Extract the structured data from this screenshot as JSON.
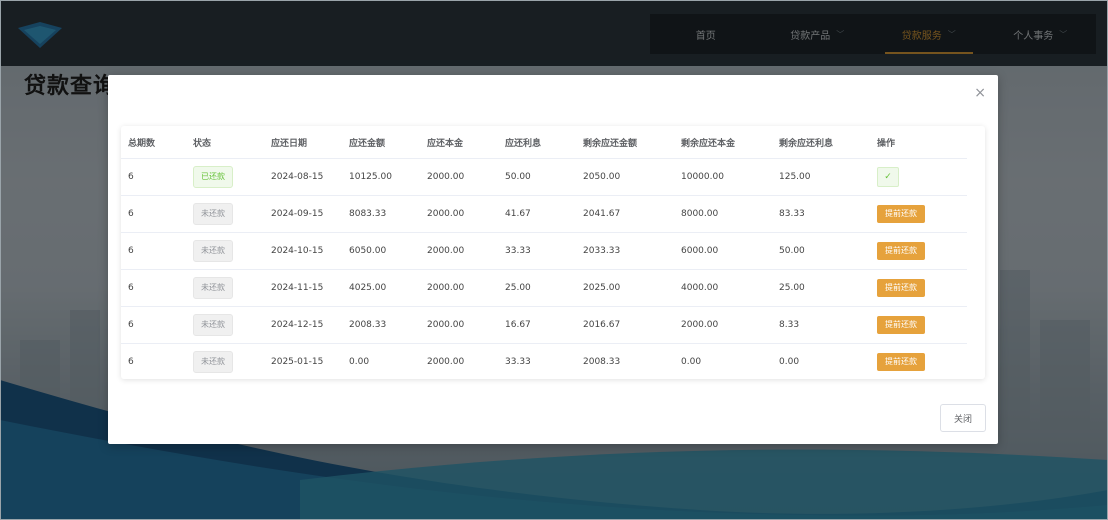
{
  "page": {
    "title": "贷款查询"
  },
  "nav": {
    "items": [
      {
        "label": "首页",
        "chevron": false,
        "active": false
      },
      {
        "label": "贷款产品",
        "chevron": true,
        "active": false
      },
      {
        "label": "贷款服务",
        "chevron": true,
        "active": true
      },
      {
        "label": "个人事务",
        "chevron": true,
        "active": false
      }
    ]
  },
  "colors": {
    "accent": "#e6a23c",
    "nav_active": "#e2a23a",
    "paid_green": "#67c23a"
  },
  "dialog": {
    "close_icon": "×",
    "columns": [
      "总期数",
      "状态",
      "应还日期",
      "应还金额",
      "应还本金",
      "应还利息",
      "剩余应还金额",
      "剩余应还本金",
      "剩余应还利息",
      "操作"
    ],
    "rows": [
      {
        "periods": "6",
        "status": "已还款",
        "status_type": "paid",
        "due_date": "2024-08-15",
        "amount": "10125.00",
        "principal": "2000.00",
        "interest": "50.00",
        "remaining_amount": "2050.00",
        "remaining_principal": "10000.00",
        "remaining_interest": "125.00",
        "action": "✓",
        "action_type": "done"
      },
      {
        "periods": "6",
        "status": "未还款",
        "status_type": "unpaid",
        "due_date": "2024-09-15",
        "amount": "8083.33",
        "principal": "2000.00",
        "interest": "41.67",
        "remaining_amount": "2041.67",
        "remaining_principal": "8000.00",
        "remaining_interest": "83.33",
        "action": "提前还款",
        "action_type": "button"
      },
      {
        "periods": "6",
        "status": "未还款",
        "status_type": "unpaid",
        "due_date": "2024-10-15",
        "amount": "6050.00",
        "principal": "2000.00",
        "interest": "33.33",
        "remaining_amount": "2033.33",
        "remaining_principal": "6000.00",
        "remaining_interest": "50.00",
        "action": "提前还款",
        "action_type": "button"
      },
      {
        "periods": "6",
        "status": "未还款",
        "status_type": "unpaid",
        "due_date": "2024-11-15",
        "amount": "4025.00",
        "principal": "2000.00",
        "interest": "25.00",
        "remaining_amount": "2025.00",
        "remaining_principal": "4000.00",
        "remaining_interest": "25.00",
        "action": "提前还款",
        "action_type": "button"
      },
      {
        "periods": "6",
        "status": "未还款",
        "status_type": "unpaid",
        "due_date": "2024-12-15",
        "amount": "2008.33",
        "principal": "2000.00",
        "interest": "16.67",
        "remaining_amount": "2016.67",
        "remaining_principal": "2000.00",
        "remaining_interest": "8.33",
        "action": "提前还款",
        "action_type": "button"
      },
      {
        "periods": "6",
        "status": "未还款",
        "status_type": "unpaid",
        "due_date": "2025-01-15",
        "amount": "0.00",
        "principal": "2000.00",
        "interest": "33.33",
        "remaining_amount": "2008.33",
        "remaining_principal": "0.00",
        "remaining_interest": "0.00",
        "action": "提前还款",
        "action_type": "button"
      }
    ],
    "close_label": "关闭"
  }
}
